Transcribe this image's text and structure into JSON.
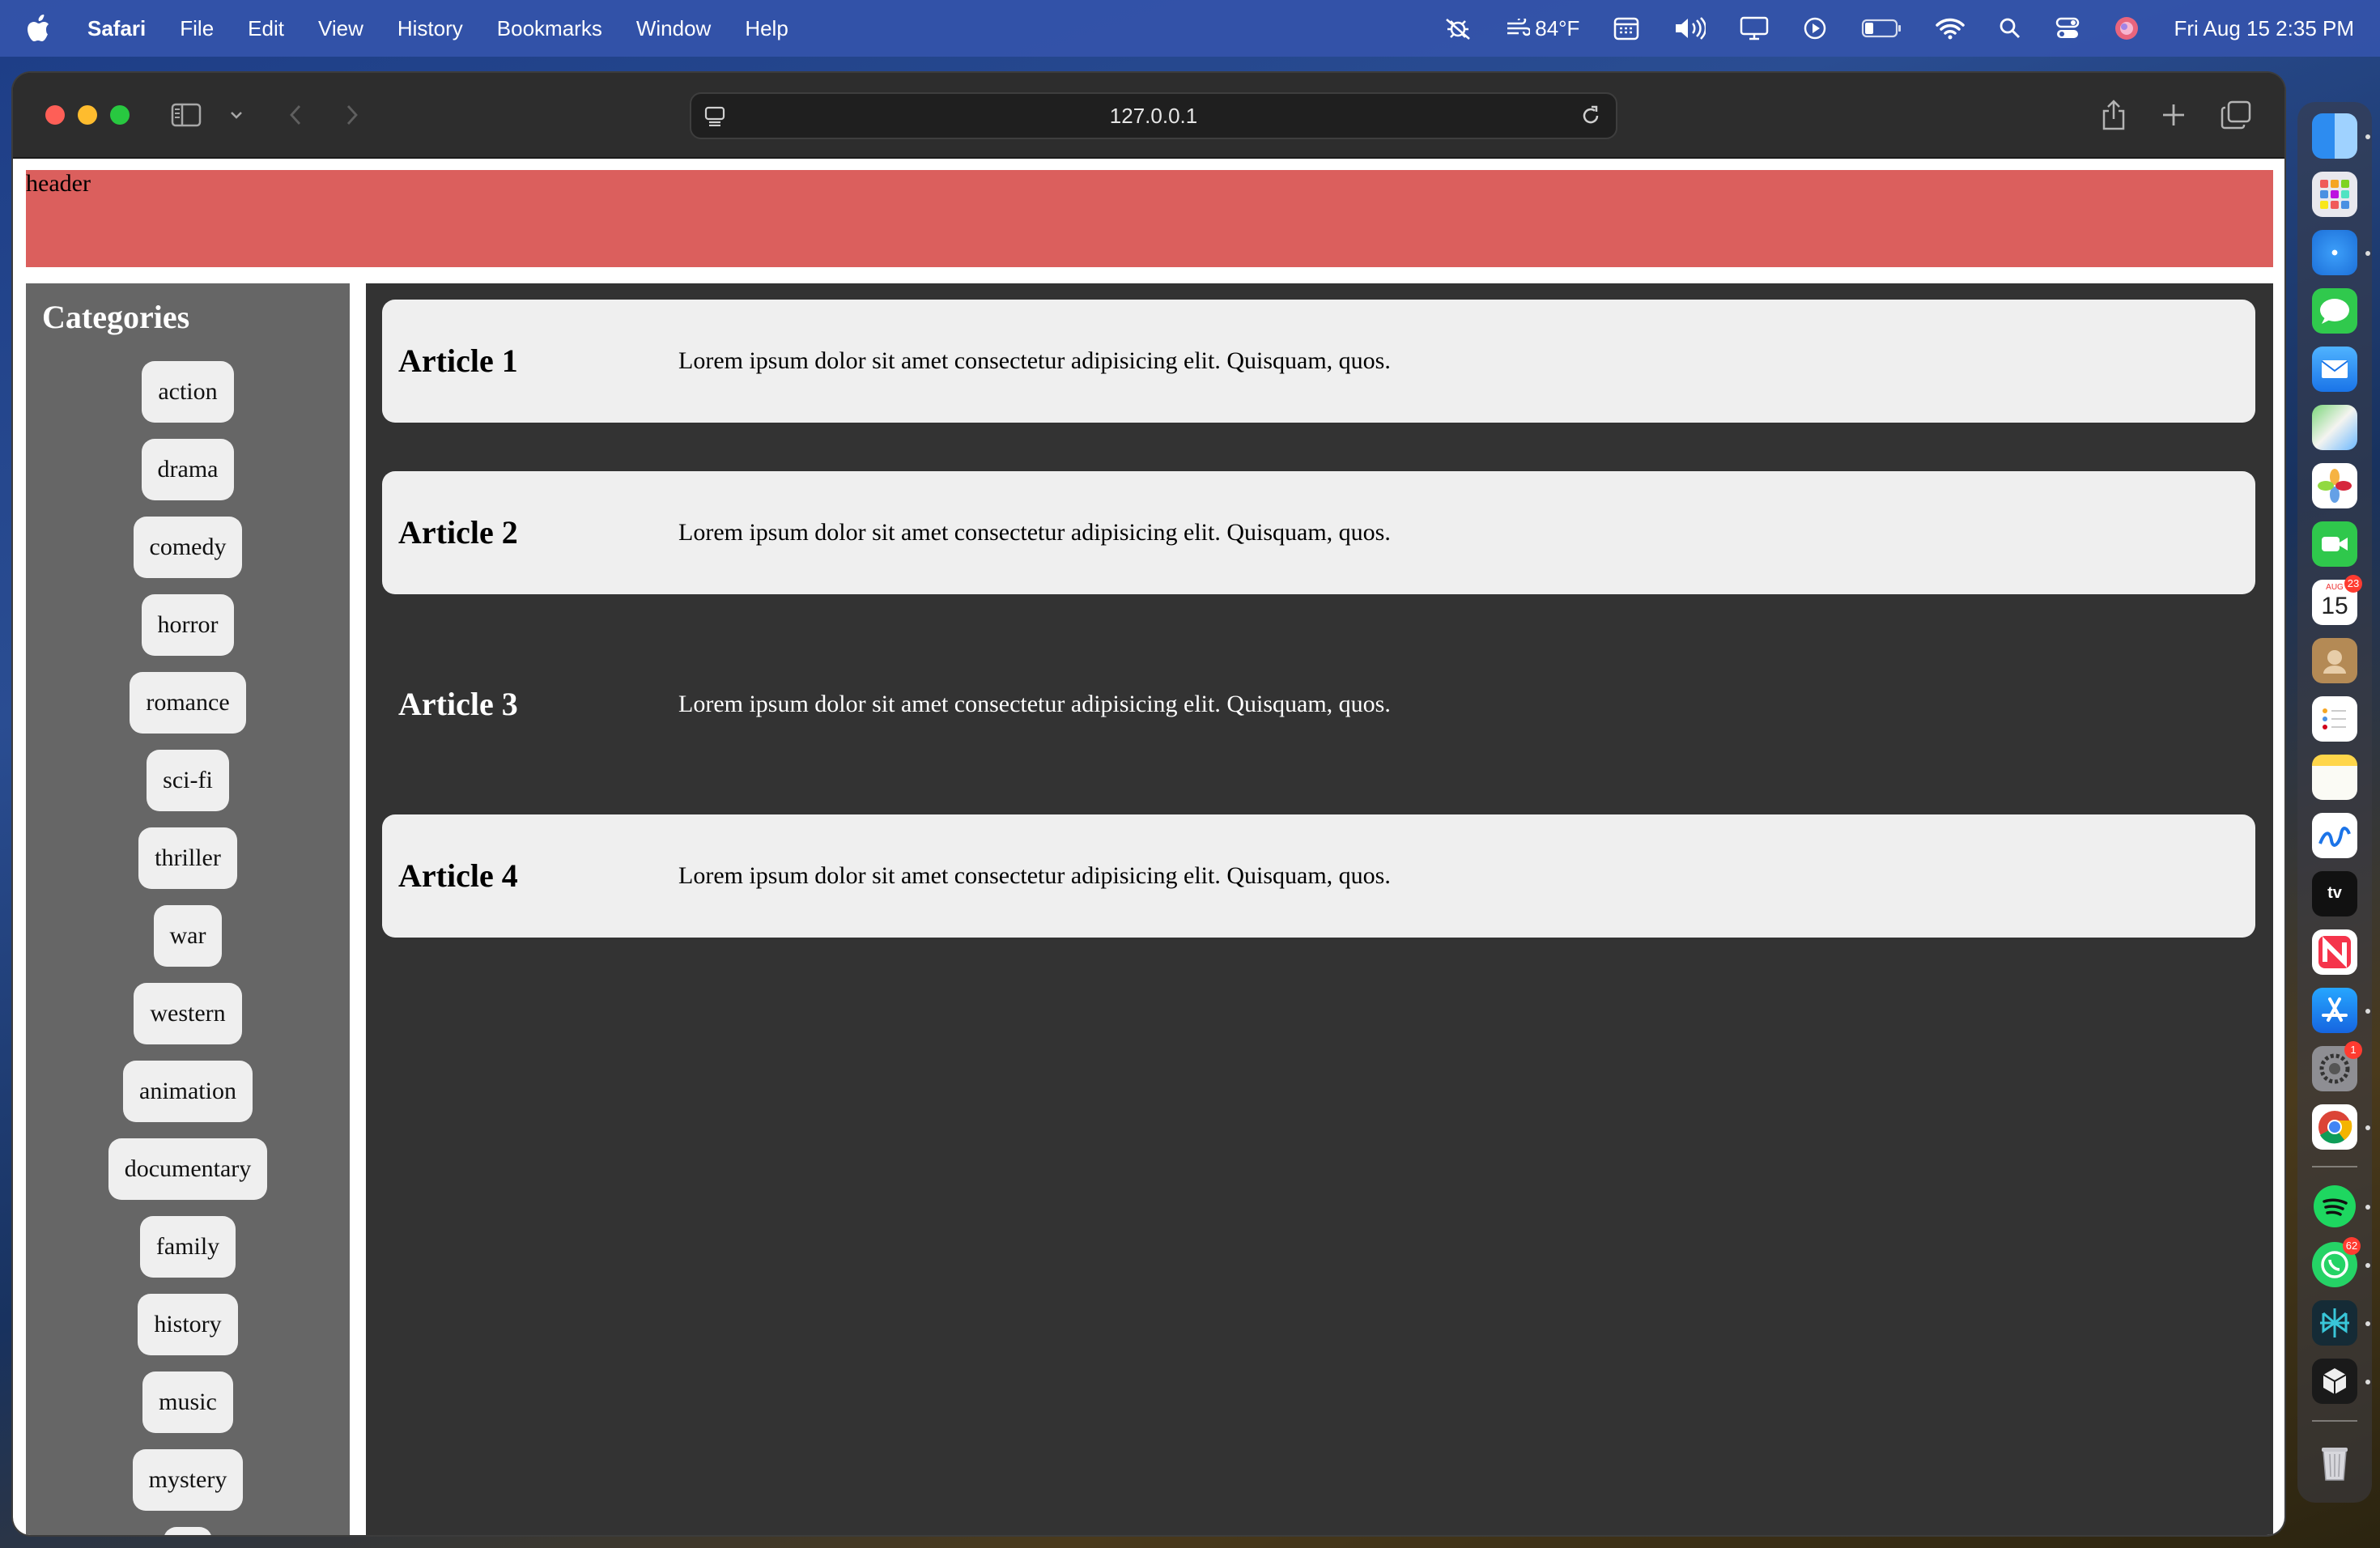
{
  "menubar": {
    "app_name": "Safari",
    "menus": [
      "File",
      "Edit",
      "View",
      "History",
      "Bookmarks",
      "Window",
      "Help"
    ],
    "weather": "84°F",
    "datetime": "Fri Aug 15  2:35 PM"
  },
  "browser": {
    "url": "127.0.0.1"
  },
  "page": {
    "header_text": "header",
    "sidebar_title": "Categories",
    "categories": [
      "action",
      "drama",
      "comedy",
      "horror",
      "romance",
      "sci-fi",
      "thriller",
      "war",
      "western",
      "animation",
      "documentary",
      "family",
      "history",
      "music",
      "mystery"
    ],
    "articles": [
      {
        "title": "Article 1",
        "body": "Lorem ipsum dolor sit amet consectetur adipisicing elit. Quisquam, quos.",
        "style": "light"
      },
      {
        "title": "Article 2",
        "body": "Lorem ipsum dolor sit amet consectetur adipisicing elit. Quisquam, quos.",
        "style": "light"
      },
      {
        "title": "Article 3",
        "body": "Lorem ipsum dolor sit amet consectetur adipisicing elit. Quisquam, quos.",
        "style": "dark"
      },
      {
        "title": "Article 4",
        "body": "Lorem ipsum dolor sit amet consectetur adipisicing elit. Quisquam, quos.",
        "style": "light"
      }
    ]
  },
  "dock": {
    "calendar_month": "AUG",
    "calendar_day": "15",
    "calendar_badge": "23",
    "settings_badge": "1",
    "whatsapp_badge": "62",
    "apps": [
      "finder-icon",
      "launchpad-icon",
      "safari-icon",
      "messages-icon",
      "mail-icon",
      "maps-icon",
      "photos-icon",
      "facetime-icon",
      "calendar-icon",
      "contacts-icon",
      "reminders-icon",
      "notes-icon",
      "freeform-icon",
      "apple-tv-icon",
      "news-icon",
      "app-store-icon",
      "system-settings-icon",
      "chrome-icon",
      "spotify-icon",
      "whatsapp-icon",
      "perplexity-icon",
      "cursor-icon",
      "trash-icon"
    ]
  }
}
